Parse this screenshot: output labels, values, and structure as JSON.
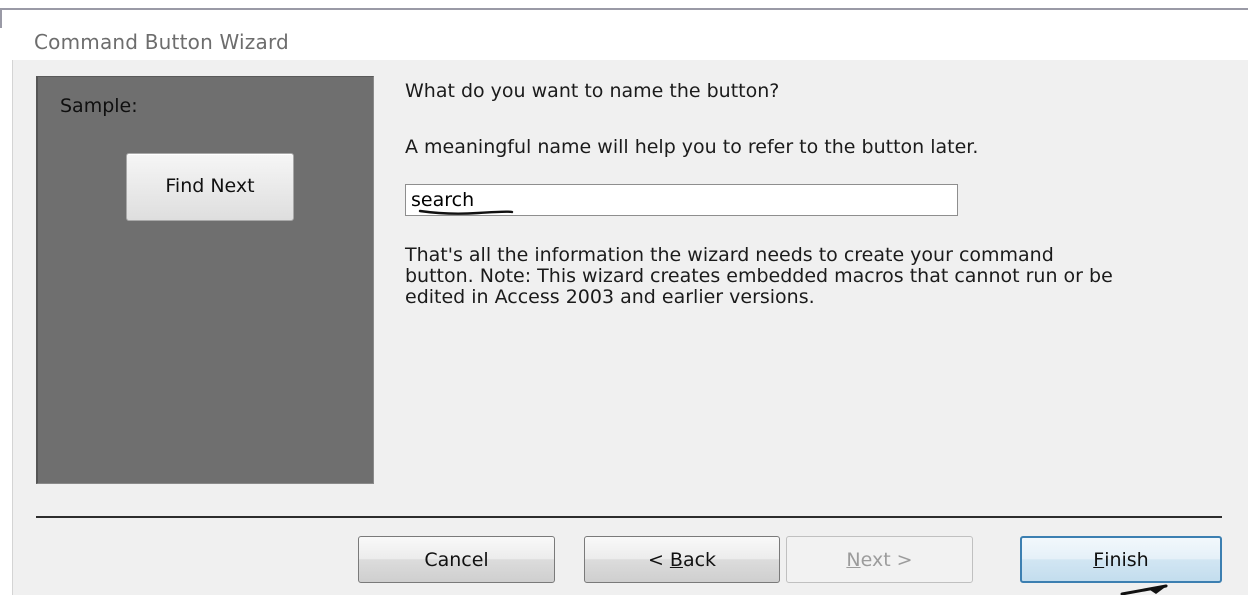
{
  "window": {
    "title": "Command Button Wizard"
  },
  "sample": {
    "label": "Sample:",
    "button_text": "Find Next"
  },
  "prompt": {
    "question": "What do you want to name the button?",
    "hint": "A meaningful name will help you to refer to the button later."
  },
  "name_field": {
    "value": "search"
  },
  "info": {
    "text": "That's all the information the wizard needs to create your command button. Note: This wizard creates embedded macros that cannot run or be edited in Access 2003 and earlier versions."
  },
  "buttons": {
    "cancel": "Cancel",
    "back_prefix": "< ",
    "back_mnemonic": "B",
    "back_rest": "ack",
    "next_mnemonic": "N",
    "next_rest": "ext >",
    "finish_mnemonic": "F",
    "finish_rest": "inish"
  },
  "colors": {
    "sample_panel": "#6f6f6f",
    "dialog_background": "#f0f0f0",
    "default_button_border": "#3c7fb1"
  },
  "icons": {
    "arrow_annotation": "pen-stroke-arrow-icon",
    "underline_annotation": "pen-underline-icon"
  }
}
